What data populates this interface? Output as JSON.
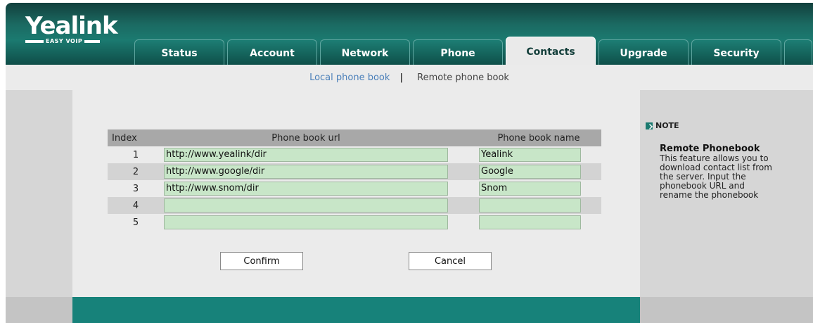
{
  "brand": {
    "logo": "Yealink",
    "tagline": "EASY VOIP"
  },
  "tabs": [
    {
      "label": "Status"
    },
    {
      "label": "Account"
    },
    {
      "label": "Network"
    },
    {
      "label": "Phone"
    },
    {
      "label": "Contacts",
      "active": true
    },
    {
      "label": "Upgrade"
    },
    {
      "label": "Security"
    }
  ],
  "submenu": {
    "local": "Local phone book",
    "separator": "|",
    "remote": "Remote phone book"
  },
  "table": {
    "headers": {
      "index": "Index",
      "url": "Phone book url",
      "name": "Phone book name"
    },
    "rows": [
      {
        "index": "1",
        "url": "http://www.yealink/dir",
        "name": "Yealink"
      },
      {
        "index": "2",
        "url": "http://www.google/dir",
        "name": "Google"
      },
      {
        "index": "3",
        "url": "http://www.snom/dir",
        "name": "Snom"
      },
      {
        "index": "4",
        "url": "",
        "name": ""
      },
      {
        "index": "5",
        "url": "",
        "name": ""
      }
    ]
  },
  "buttons": {
    "confirm": "Confirm",
    "cancel": "Cancel"
  },
  "note": {
    "label": "NOTE",
    "title": "Remote Phonebook",
    "body": "This feature allows you to download contact list from the server. Input the phonebook URL and rename the phonebook"
  },
  "colors": {
    "header": "#1b7a70",
    "field": "#c8e6c8",
    "footer": "#17827a"
  }
}
